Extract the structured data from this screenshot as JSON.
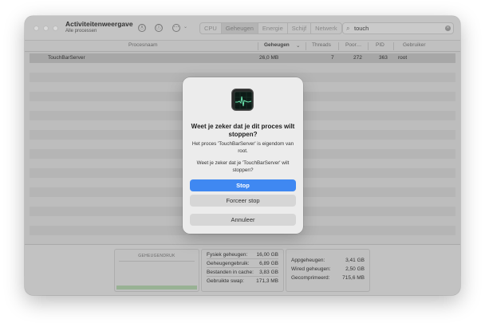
{
  "window": {
    "title": "Activiteitenweergave",
    "subtitle": "Alle processen"
  },
  "toolbar": {
    "close_icon": "ⓧ",
    "info_icon": "ⓘ",
    "more_icon": "⋯",
    "chevron": "⌄",
    "tabs": [
      {
        "label": "CPU"
      },
      {
        "label": "Geheugen"
      },
      {
        "label": "Energie"
      },
      {
        "label": "Schijf"
      },
      {
        "label": "Netwerk"
      }
    ],
    "active_tab": "Geheugen",
    "search": {
      "value": "touch",
      "icon": "⌕",
      "clear_icon": "✕"
    }
  },
  "columns": {
    "process_name": "Procesnaam",
    "memory": "Geheugen",
    "sort_indicator": "⌄",
    "threads": "Threads",
    "ports": "Poor…",
    "pid": "PID",
    "user": "Gebruiker"
  },
  "rows": [
    {
      "name": "TouchBarServer",
      "memory": "26,0 MB",
      "threads": "7",
      "ports": "272",
      "pid": "363",
      "user": "root"
    }
  ],
  "stats": {
    "gauge_title": "GEHEUGENDRUK",
    "gauge_level_percent": 12,
    "gauge_color": "#98b294",
    "left": [
      {
        "label": "Fysiek geheugen:",
        "value": "16,00 GB"
      },
      {
        "label": "Geheugengebruik:",
        "value": "6,89 GB"
      },
      {
        "label": "Bestanden in cache:",
        "value": "3,83 GB"
      },
      {
        "label": "Gebruikte swap:",
        "value": "171,3 MB"
      }
    ],
    "right": [
      {
        "label": "Appgeheugen:",
        "value": "3,41 GB"
      },
      {
        "label": "Wired geheugen:",
        "value": "2,50 GB"
      },
      {
        "label": "Gecomprimeerd:",
        "value": "715,6 MB"
      }
    ]
  },
  "dialog": {
    "icon": "activity-monitor-icon",
    "title": "Weet je zeker dat je dit proces wilt stoppen?",
    "message1": "Het proces 'TouchBarServer' is eigendom van root.",
    "message2": "Weet je zeker dat je 'TouchBarServer' wilt stoppen?",
    "stop_label": "Stop",
    "force_stop_label": "Forceer stop",
    "cancel_label": "Annuleer",
    "accent_color": "#3f88f2"
  }
}
